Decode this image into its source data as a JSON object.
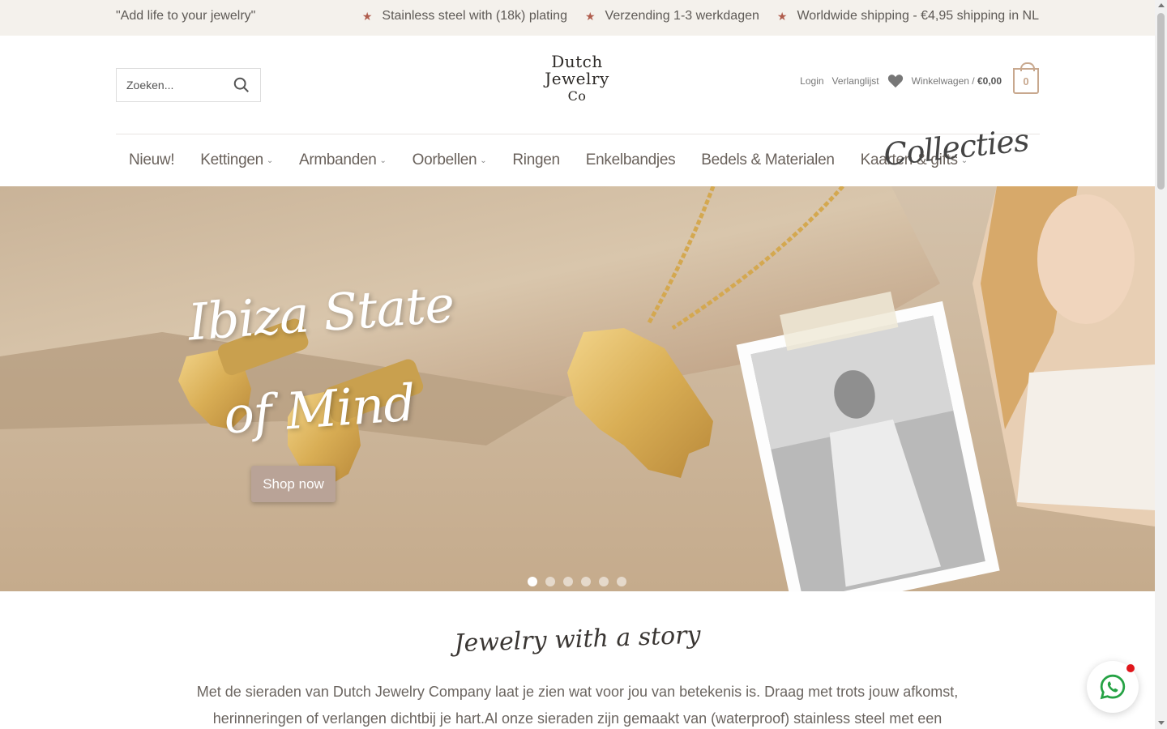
{
  "topbar": {
    "quote": "\"Add life to your jewelry\"",
    "usps": [
      "Stainless steel with (18k) plating",
      "Verzending 1-3 werkdagen",
      "Worldwide shipping - €4,95 shipping in NL"
    ],
    "star_icon": "star-icon"
  },
  "header": {
    "search_placeholder": "Zoeken...",
    "logo_lines": [
      "Dutch",
      "Jewelry",
      "Co"
    ],
    "login": "Login",
    "wishlist": "Verlanglijst",
    "cart_label": "Winkelwagen /",
    "cart_total": "€0,00",
    "cart_count": "0"
  },
  "nav": {
    "items": [
      {
        "label": "Nieuw!",
        "dropdown": false
      },
      {
        "label": "Kettingen",
        "dropdown": true
      },
      {
        "label": "Armbanden",
        "dropdown": true
      },
      {
        "label": "Oorbellen",
        "dropdown": true
      },
      {
        "label": "Ringen",
        "dropdown": false
      },
      {
        "label": "Enkelbandjes",
        "dropdown": false
      },
      {
        "label": "Bedels & Materialen",
        "dropdown": false
      },
      {
        "label": "Kaarten & gifts",
        "dropdown": true
      }
    ],
    "collecties": "Collecties"
  },
  "hero": {
    "title_line1": "Ibiza State",
    "title_line2": "of Mind",
    "button": "Shop now",
    "slides": 6,
    "active_slide": 1
  },
  "intro": {
    "title": "Jewelry with a story",
    "text": "Met de sieraden van Dutch Jewelry Company laat je zien wat voor jou van betekenis is. Draag met trots jouw afkomst, herinneringen of verlangen dichtbij je hart.Al onze sieraden zijn gemaakt van (waterproof) stainless steel met een plating. Zo kun je er jaren van genieten!"
  },
  "colors": {
    "topbar_bg": "#f4f1ec",
    "star": "#b05d4d",
    "accent": "#c8a88e",
    "button": "#b9a397"
  }
}
